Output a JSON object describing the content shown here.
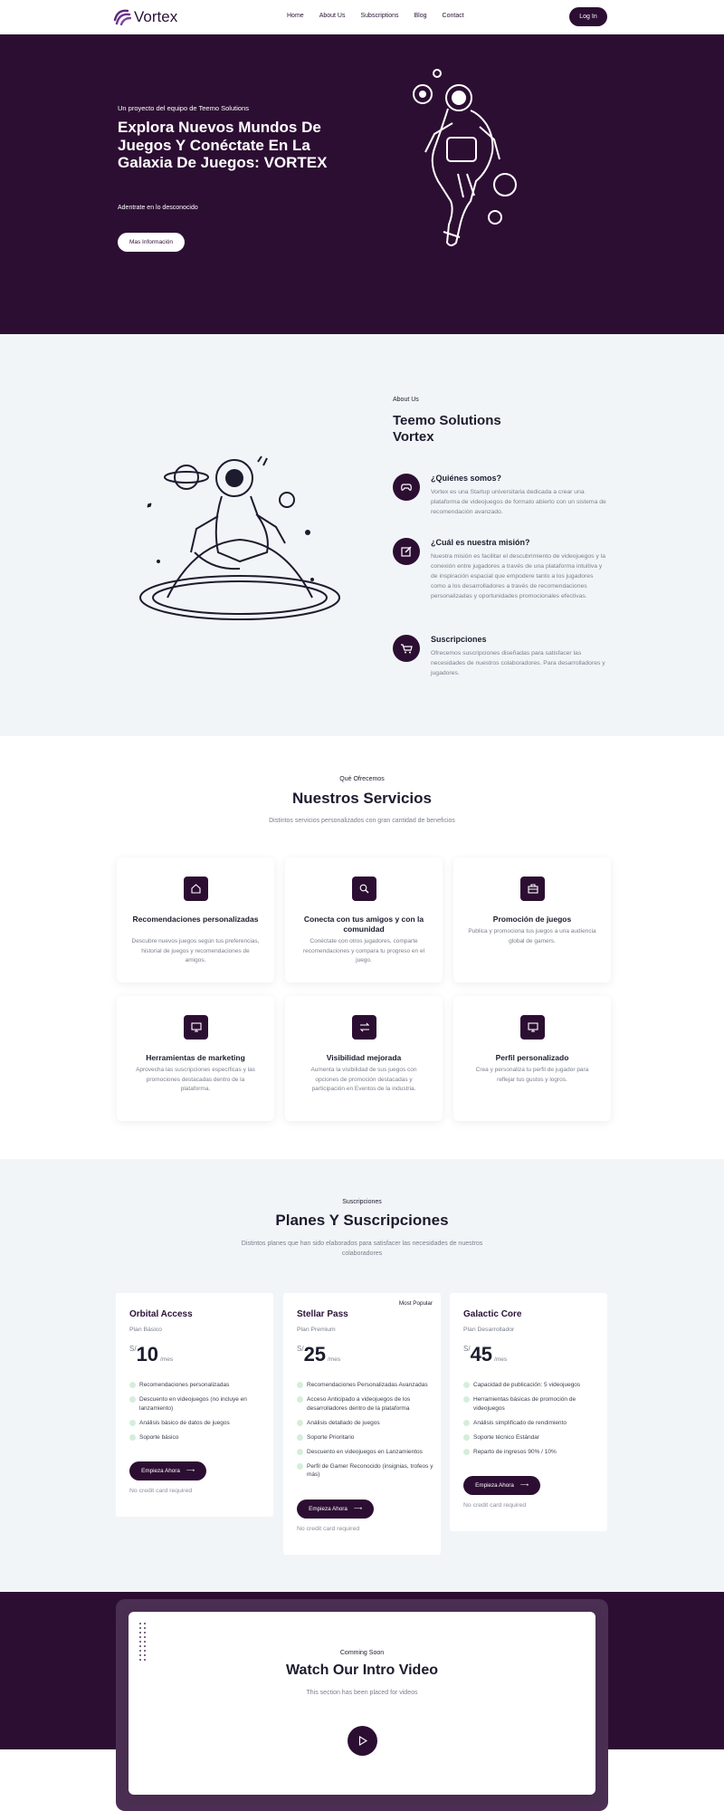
{
  "nav": {
    "brand": "Vortex",
    "links": [
      "Home",
      "About Us",
      "Subscriptions",
      "Blog",
      "Contact"
    ],
    "login": "Log In"
  },
  "hero": {
    "kicker": "Un proyecto del equipo de Teemo Solutions",
    "title": "Explora Nuevos Mundos De Juegos Y Conéctate En La Galaxia De Juegos: VORTEX",
    "subtitle": "Adentrate en lo desconocido",
    "button": "Mas Información"
  },
  "about": {
    "kicker": "About Us",
    "title": "Teemo Solutions Vortex",
    "items": [
      {
        "icon": "gamepad-icon",
        "title": "¿Quiénes somos?",
        "text": "Vortex es una Startup universitaria dedicada a crear una plataforma de videojuegos de formato abierto con un sistema de recomendación avanzado."
      },
      {
        "icon": "edit-icon",
        "title": "¿Cuál es nuestra misión?",
        "text": "Nuestra misión es facilitar el descubrimiento de videojuegos y la conexión entre jugadores a través de una plataforma intuitiva y de inspiración espacial que empodere tanto a los jugadores como a los desarrolladores a través de recomendaciones personalizadas y oportunidades promocionales efectivas."
      },
      {
        "icon": "cart-icon",
        "title": "Suscripciones",
        "text": "Ofrecemos suscripciones diseñadas para satisfacer las necesidades de nuestros colaboradores. Para desarrolladores y jugadores."
      }
    ]
  },
  "services": {
    "kicker": "Qué Ofrecemos",
    "title": "Nuestros Servicios",
    "subtitle": "Distintos servicios personalizados con gran cantidad de beneficios",
    "cards": [
      {
        "icon": "home-icon",
        "title": "Recomendaciones personalizadas",
        "text": "Descubre nuevos juegos según tus preferencias, historial de juegos y recomendaciones de amigos."
      },
      {
        "icon": "search-icon",
        "title": "Conecta con tus amigos y con la comunidad",
        "text": "Conéctate con otros jugadores, comparte recomendaciones y compara tu progreso en el juego."
      },
      {
        "icon": "briefcase-icon",
        "title": "Promoción de juegos",
        "text": "Publica y promociona tus juegos a una audiencia global de gamers."
      },
      {
        "icon": "monitor-icon",
        "title": "Herramientas de marketing",
        "text": "Aprovecha las suscripciones específicas y las promociones destacadas dentro de la plataforma."
      },
      {
        "icon": "transfer-icon",
        "title": "Visibilidad mejorada",
        "text": "Aumenta la visibilidad de sus juegos con opciones de promoción destacadas y participación en Eventos de la industria."
      },
      {
        "icon": "monitor-icon",
        "title": "Perfil personalizado",
        "text": "Crea y personaliza tu perfil de jugador para reflejar tus gustos y logros."
      }
    ]
  },
  "plans": {
    "kicker": "Suscripciones",
    "title": "Planes Y Suscripciones",
    "subtitle": "Distintos planes que han sido elaborados para satisfacer las necesidades de nuestros colaboradores",
    "items": [
      {
        "name": "Orbital Access",
        "level": "Plan Básico",
        "currency": "S/",
        "price": "10",
        "period": "/mes",
        "badge": "",
        "features": [
          "Recomendaciones personalizadas",
          "Descuento en videojuegos (no incluye en lanzamiento)",
          "Análisis básico de datos de juegos",
          "Soporte básico"
        ],
        "button": "Empieza Ahora",
        "note": "No credit card required"
      },
      {
        "name": "Stellar Pass",
        "level": "Plan Premium",
        "currency": "S/",
        "price": "25",
        "period": "/mes",
        "badge": "Most Popular",
        "features": [
          "Recomendaciones Personalizadas Avanzadas",
          "Acceso Anticipado a videojuegos de los desarrolladores dentro de la plataforma",
          "Análisis detallado de juegos",
          "Soporte Prioritario",
          "Descuento en videojuegos en Lanzamientos",
          "Perfil de Gamer Reconocido (insignias, trofeos y más)"
        ],
        "button": "Empieza Ahora",
        "note": "No credit card required"
      },
      {
        "name": "Galactic Core",
        "level": "Plan Desarrollador",
        "currency": "S/",
        "price": "45",
        "period": "/mes",
        "badge": "",
        "features": [
          "Capacidad de publicación: 5 videojuegos",
          "Herramientas básicas de promoción de videojuegos",
          "Análisis simplificado de rendimiento",
          "Soporte técnico Estándar",
          "Reparto de ingresos 90% / 10%"
        ],
        "button": "Empieza Ahora",
        "note": "No credit card required"
      }
    ]
  },
  "video": {
    "kicker": "Comming Soon",
    "title": "Watch Our Intro Video",
    "subtitle": "This section has been placed for videos"
  },
  "colors": {
    "brand": "#2d0e33",
    "background_light": "#f2f5f8",
    "check": "#d4eedb"
  }
}
